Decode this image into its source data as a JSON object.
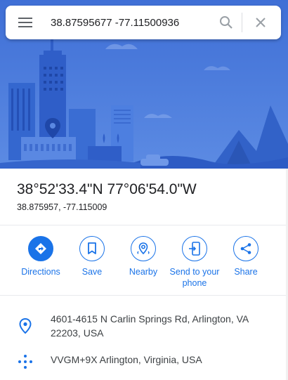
{
  "search": {
    "value": "38.87595677 -77.11500936",
    "menu_icon": "hamburger-menu-icon",
    "search_icon": "search-icon",
    "close_icon": "close-icon"
  },
  "place": {
    "title": "38°52'33.4\"N 77°06'54.0\"W",
    "subtitle": "38.875957, -77.115009"
  },
  "actions": [
    {
      "label": "Directions",
      "icon": "directions-icon"
    },
    {
      "label": "Save",
      "icon": "bookmark-icon"
    },
    {
      "label": "Nearby",
      "icon": "nearby-icon"
    },
    {
      "label": "Send to your phone",
      "icon": "send-to-phone-icon"
    },
    {
      "label": "Share",
      "icon": "share-icon"
    }
  ],
  "info": {
    "address": "4601-4615 N Carlin Springs Rd, Arlington, VA 22203, USA",
    "plus_code": "VVGM+9X Arlington, Virginia, USA"
  },
  "colors": {
    "accent": "#1a73e8",
    "hero_bg": "#4a78d9"
  }
}
